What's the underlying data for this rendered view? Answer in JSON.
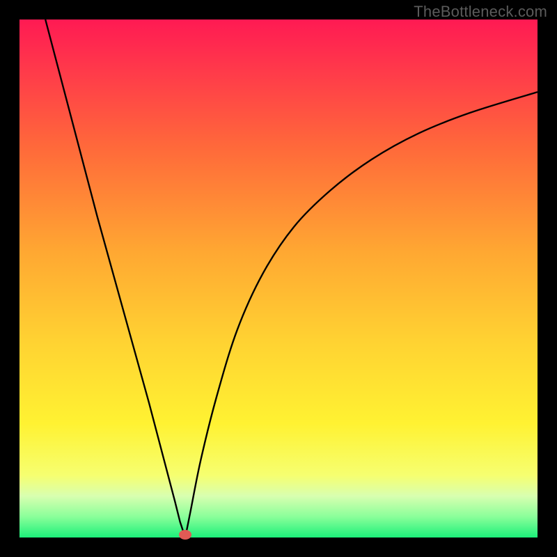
{
  "watermark": "TheBottleneck.com",
  "chart_data": {
    "type": "line",
    "title": "",
    "xlabel": "",
    "ylabel": "",
    "xlim": [
      0,
      100
    ],
    "ylim": [
      0,
      100
    ],
    "minimum_marker": {
      "x": 32,
      "y": 0
    },
    "left_branch": {
      "x": [
        5,
        10,
        15,
        20,
        25,
        30,
        31,
        32
      ],
      "y": [
        100,
        81,
        62,
        44,
        26,
        7,
        3,
        0
      ]
    },
    "right_branch": {
      "x": [
        32,
        33,
        35,
        38,
        42,
        47,
        53,
        60,
        68,
        77,
        87,
        100
      ],
      "y": [
        0,
        5,
        15,
        27,
        40,
        51,
        60,
        67,
        73,
        78,
        82,
        86
      ]
    },
    "gradient_stops": [
      {
        "pos": 0,
        "color": "#ff1a53"
      },
      {
        "pos": 25,
        "color": "#ff6a3a"
      },
      {
        "pos": 62,
        "color": "#ffd232"
      },
      {
        "pos": 88,
        "color": "#f6ff70"
      },
      {
        "pos": 100,
        "color": "#1cf07a"
      }
    ]
  }
}
